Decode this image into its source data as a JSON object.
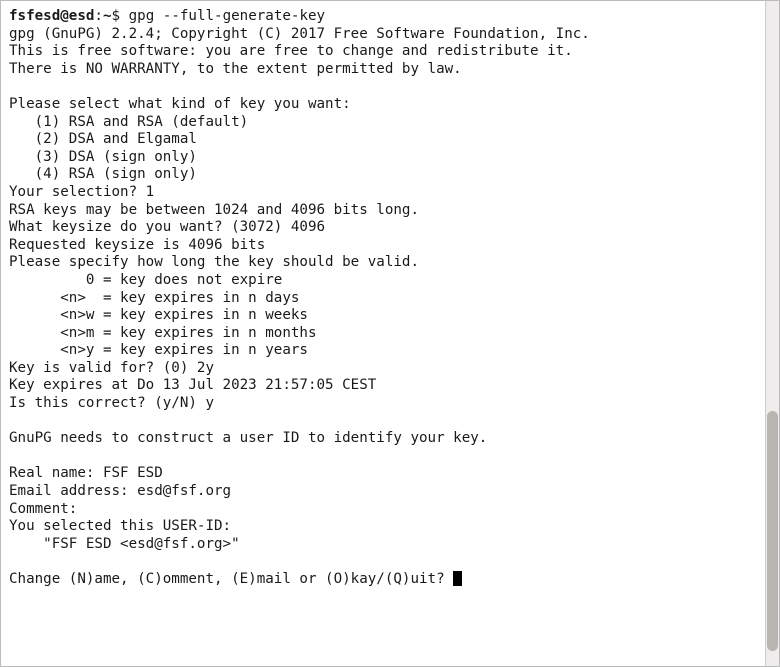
{
  "prompt": {
    "userhost": "fsfesd@esd",
    "sep": ":",
    "path": "~",
    "symbol": "$",
    "command": "gpg --full-generate-key"
  },
  "lines": {
    "l01": "gpg (GnuPG) 2.2.4; Copyright (C) 2017 Free Software Foundation, Inc.",
    "l02": "This is free software: you are free to change and redistribute it.",
    "l03": "There is NO WARRANTY, to the extent permitted by law.",
    "l04": "",
    "l05": "Please select what kind of key you want:",
    "l06": "   (1) RSA and RSA (default)",
    "l07": "   (2) DSA and Elgamal",
    "l08": "   (3) DSA (sign only)",
    "l09": "   (4) RSA (sign only)",
    "l10": "Your selection? 1",
    "l11": "RSA keys may be between 1024 and 4096 bits long.",
    "l12": "What keysize do you want? (3072) 4096",
    "l13": "Requested keysize is 4096 bits",
    "l14": "Please specify how long the key should be valid.",
    "l15": "         0 = key does not expire",
    "l16": "      <n>  = key expires in n days",
    "l17": "      <n>w = key expires in n weeks",
    "l18": "      <n>m = key expires in n months",
    "l19": "      <n>y = key expires in n years",
    "l20": "Key is valid for? (0) 2y",
    "l21": "Key expires at Do 13 Jul 2023 21:57:05 CEST",
    "l22": "Is this correct? (y/N) y",
    "l23": "",
    "l24": "GnuPG needs to construct a user ID to identify your key.",
    "l25": "",
    "l26": "Real name: FSF ESD",
    "l27": "Email address: esd@fsf.org",
    "l28": "Comment:",
    "l29": "You selected this USER-ID:",
    "l30": "    \"FSF ESD <esd@fsf.org>\"",
    "l31": "",
    "l32": "Change (N)ame, (C)omment, (E)mail or (O)kay/(Q)uit? "
  }
}
